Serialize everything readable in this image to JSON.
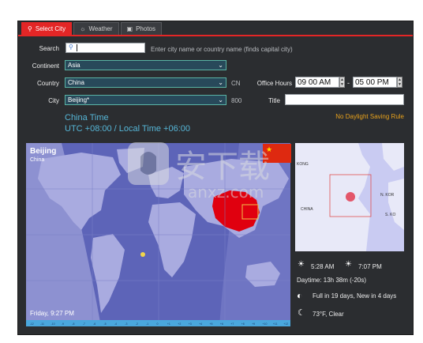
{
  "tabs": [
    {
      "label": "Select City",
      "icon": "location-pin-icon",
      "active": true
    },
    {
      "label": "Weather",
      "icon": "weather-icon",
      "active": false
    },
    {
      "label": "Photos",
      "icon": "photo-icon",
      "active": false
    }
  ],
  "search": {
    "label": "Search",
    "value": "",
    "hint": "Enter city name or country name (finds capital city)"
  },
  "continent": {
    "label": "Continent",
    "value": "Asia"
  },
  "country": {
    "label": "Country",
    "value": "China",
    "code": "CN"
  },
  "city": {
    "label": "City",
    "value": "Beijing*",
    "code": "800"
  },
  "office_hours": {
    "label": "Office Hours",
    "start": "09 00 AM",
    "separator": "-",
    "end": "05 00 PM"
  },
  "title_field": {
    "label": "Title",
    "value": ""
  },
  "timezone": {
    "name": "China Time",
    "offset": "UTC +08:00 / Local Time +06:00"
  },
  "dst_note": "No Daylight Saving Rule",
  "map": {
    "city": "Beijing",
    "country": "China",
    "local_time": "Friday, 9:27 PM",
    "timeline_labels": [
      "-12",
      "-11",
      "-10",
      "-9",
      "-8",
      "-7",
      "-6",
      "-5",
      "-4",
      "-3",
      "-2",
      "-1",
      "0",
      "+1",
      "+2",
      "+3",
      "+4",
      "+5",
      "+6",
      "+7",
      "+8",
      "+9",
      "+10",
      "+11",
      "+12"
    ]
  },
  "minimap": {
    "labels": [
      "KONG",
      "CHINA",
      "N. KOR",
      "S. KO"
    ]
  },
  "sun": {
    "sunrise": "5:28 AM",
    "sunset": "7:07 PM",
    "daytime": "Daytime: 13h 38m (-20s)"
  },
  "moon": {
    "text": "Full in 19 days, New in 4 days"
  },
  "weather": {
    "text": "73°F, Clear"
  },
  "watermark": {
    "title": "安下载",
    "subtitle": "anxz.com"
  },
  "colors": {
    "accent": "#e32626",
    "field_border": "#59b3a4",
    "tz_text": "#56b6d7",
    "dst_text": "#e8a21c",
    "map_ocean": "#5d64b8",
    "china": "#e0000f"
  }
}
